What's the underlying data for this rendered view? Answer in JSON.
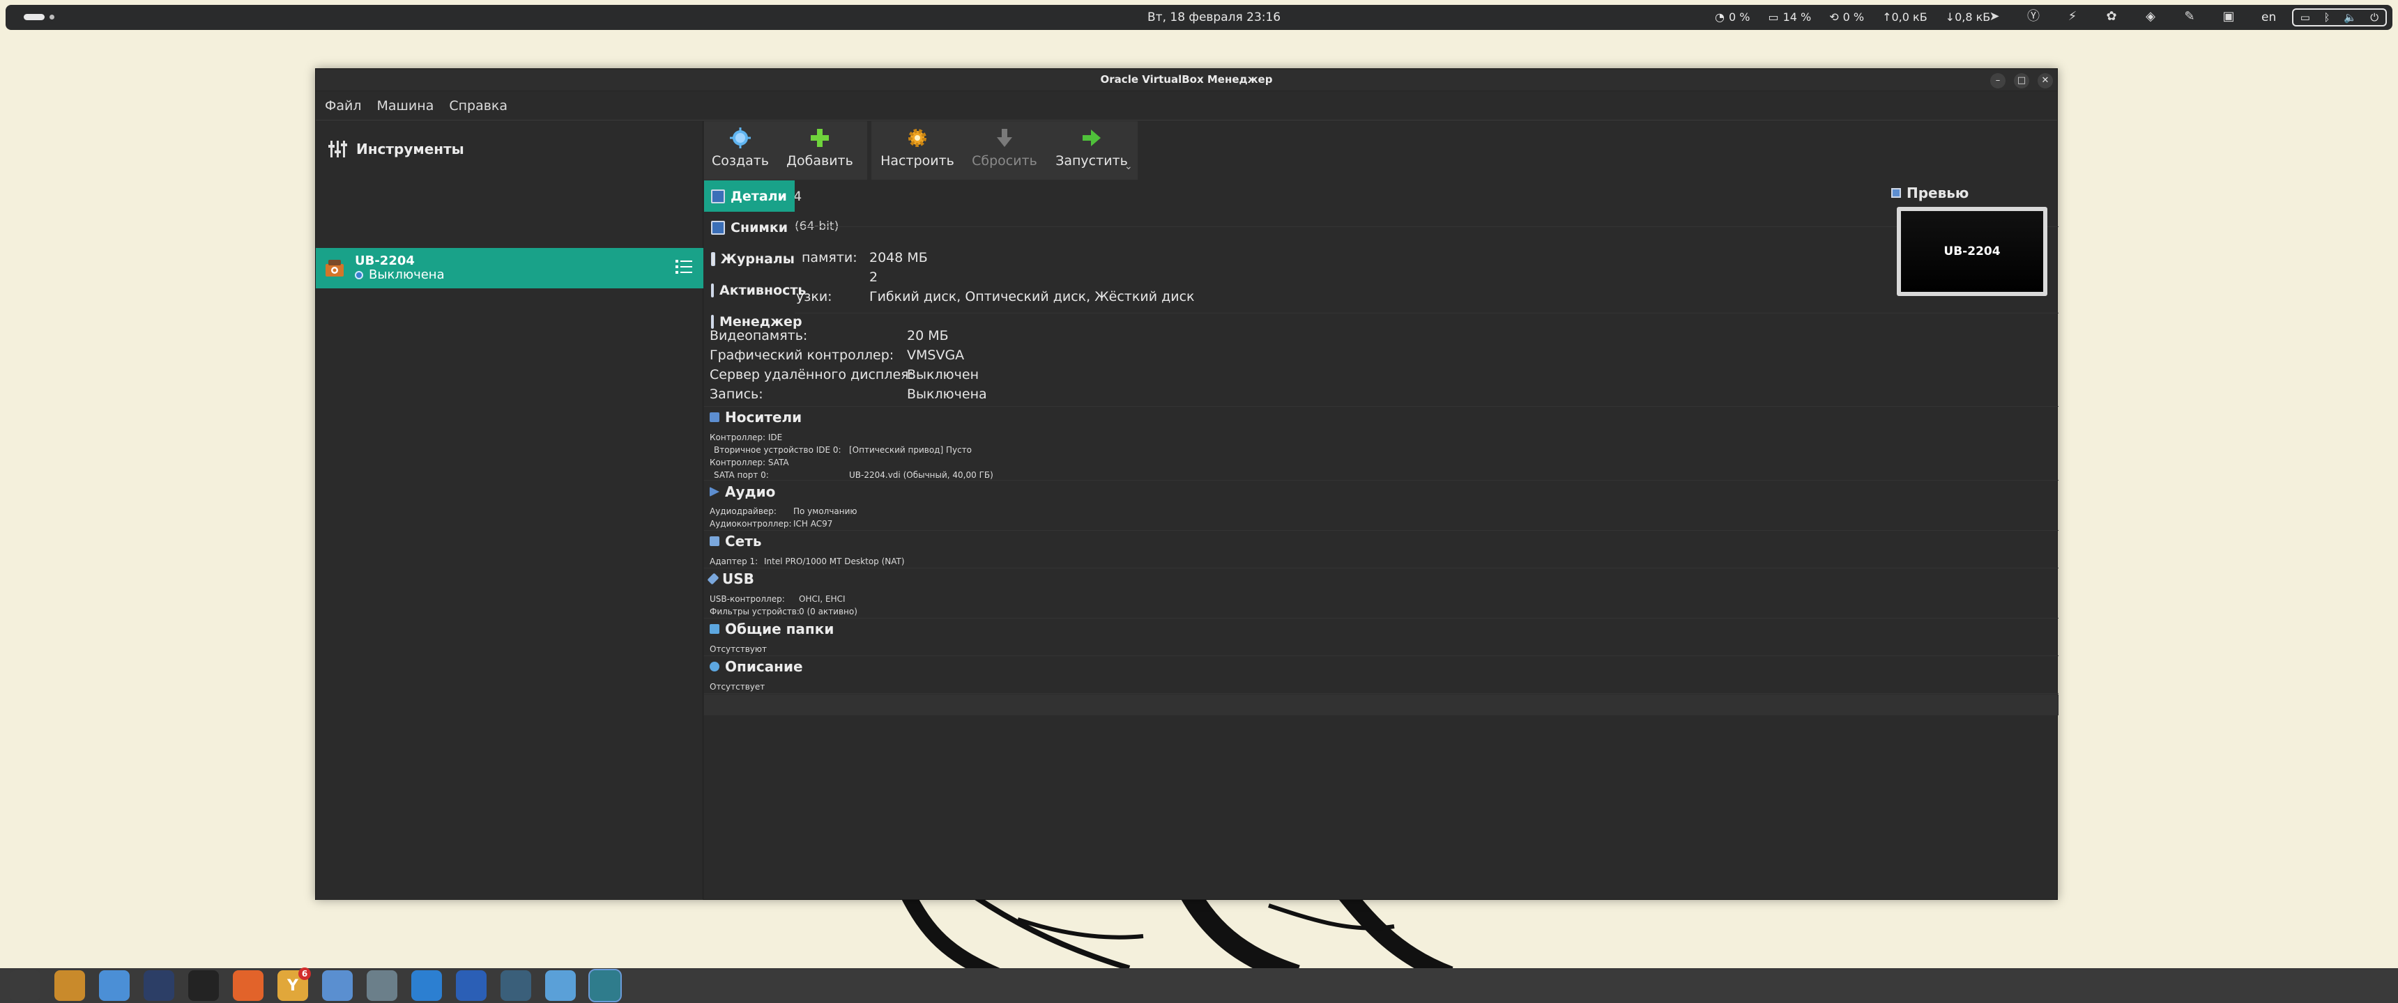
{
  "top_bar": {
    "clock": "Вт, 18 февраля  23:16",
    "stats": [
      {
        "icon": "cpu-icon",
        "label": "0 %"
      },
      {
        "icon": "memory-icon",
        "label": "14 %"
      },
      {
        "icon": "swap-icon",
        "label": "0 %"
      },
      {
        "icon": "upload-icon",
        "label": "↑0,0 кБ"
      },
      {
        "icon": "download-icon",
        "label": "↓0,8 кБ"
      }
    ],
    "language": "en"
  },
  "window": {
    "title": "Oracle VirtualBox Менеджер",
    "menu": [
      "Файл",
      "Машина",
      "Справка"
    ]
  },
  "left_pane": {
    "tools_label": "Инструменты",
    "vm": {
      "name": "UB-2204",
      "state": "Выключена"
    }
  },
  "toolbar": {
    "main": [
      {
        "label": "Создать",
        "icon": "create-icon"
      },
      {
        "label": "Добавить",
        "icon": "add-icon"
      }
    ],
    "vm": [
      {
        "label": "Настроить",
        "icon": "settings-icon"
      },
      {
        "label": "Сбросить",
        "icon": "discard-icon"
      },
      {
        "label": "Запустить",
        "icon": "start-icon"
      }
    ]
  },
  "tool_tabs": [
    "Детали",
    "Снимки",
    "Журналы",
    "Активность",
    "Менеджер"
  ],
  "details": {
    "general_fragments": {
      "name_tail": "04",
      "os_tail": "(64-bit)"
    },
    "system": [
      {
        "key": "памяти:",
        "value": "2048 МБ"
      },
      {
        "key": "",
        "value": "2"
      },
      {
        "key": "узки:",
        "value": "Гибкий диск, Оптический диск, Жёсткий диск"
      }
    ],
    "display": [
      {
        "key": "Видеопамять:",
        "value": "20 МБ"
      },
      {
        "key": "Графический контроллер:",
        "value": "VMSVGA"
      },
      {
        "key": "Сервер удалённого дисплея:",
        "value": "Выключен"
      },
      {
        "key": "Запись:",
        "value": "Выключена"
      }
    ],
    "storage": {
      "title": "Носители",
      "lines": [
        {
          "key": "Контроллер: IDE",
          "value": ""
        },
        {
          "key": "  Вторичное устройство IDE 0:",
          "value": "[Оптический привод] Пусто"
        },
        {
          "key": "Контроллер: SATA",
          "value": ""
        },
        {
          "key": "  SATA порт 0:",
          "value": "UB-2204.vdi (Обычный, 40,00 ГБ)"
        }
      ]
    },
    "audio": {
      "title": "Аудио",
      "lines": [
        {
          "key": "Аудиодрайвер:",
          "value": "По умолчанию"
        },
        {
          "key": "Аудиоконтроллер:",
          "value": "ICH AC97"
        }
      ]
    },
    "network": {
      "title": "Сеть",
      "lines": [
        {
          "key": "Адаптер 1:",
          "value": "Intel PRO/1000 MT Desktop (NAT)"
        }
      ]
    },
    "usb": {
      "title": "USB",
      "lines": [
        {
          "key": "USB-контроллер:",
          "value": "OHCI, EHCI"
        },
        {
          "key": "Фильтры устройств:",
          "value": "0 (0 активно)"
        }
      ]
    },
    "shared": {
      "title": "Общие папки",
      "value": "Отсутствуют"
    },
    "description": {
      "title": "Описание",
      "value": "Отсутствует"
    }
  },
  "preview": {
    "title": "Превью",
    "screen_text": "UB-2204"
  },
  "taskbar": {
    "items": [
      {
        "name": "app-grid-icon",
        "color": "#3b3b3b"
      },
      {
        "name": "package-manager-icon",
        "color": "#c98a2b"
      },
      {
        "name": "finder-icon",
        "color": "#4b8fd6"
      },
      {
        "name": "docs-viewer-icon",
        "color": "#2c3e66"
      },
      {
        "name": "vector-editor-icon",
        "color": "#232323"
      },
      {
        "name": "gitlab-icon",
        "color": "#e2632a"
      },
      {
        "name": "yandex-browser-icon",
        "color": "#e1a73a",
        "badge": "6",
        "letter": "Y"
      },
      {
        "name": "telegram-icon",
        "color": "#5a8fd0"
      },
      {
        "name": "file-manager-icon",
        "color": "#6b7f8a"
      },
      {
        "name": "vscode-icon",
        "color": "#2c7fd1"
      },
      {
        "name": "vpn-icon",
        "color": "#2b5fb6"
      },
      {
        "name": "pomodoro-icon",
        "color": "#3a5f7a"
      },
      {
        "name": "virtualbox-icon",
        "color": "#5aa0d8"
      },
      {
        "name": "system-monitor-icon",
        "color": "#2f7c8c"
      }
    ]
  }
}
